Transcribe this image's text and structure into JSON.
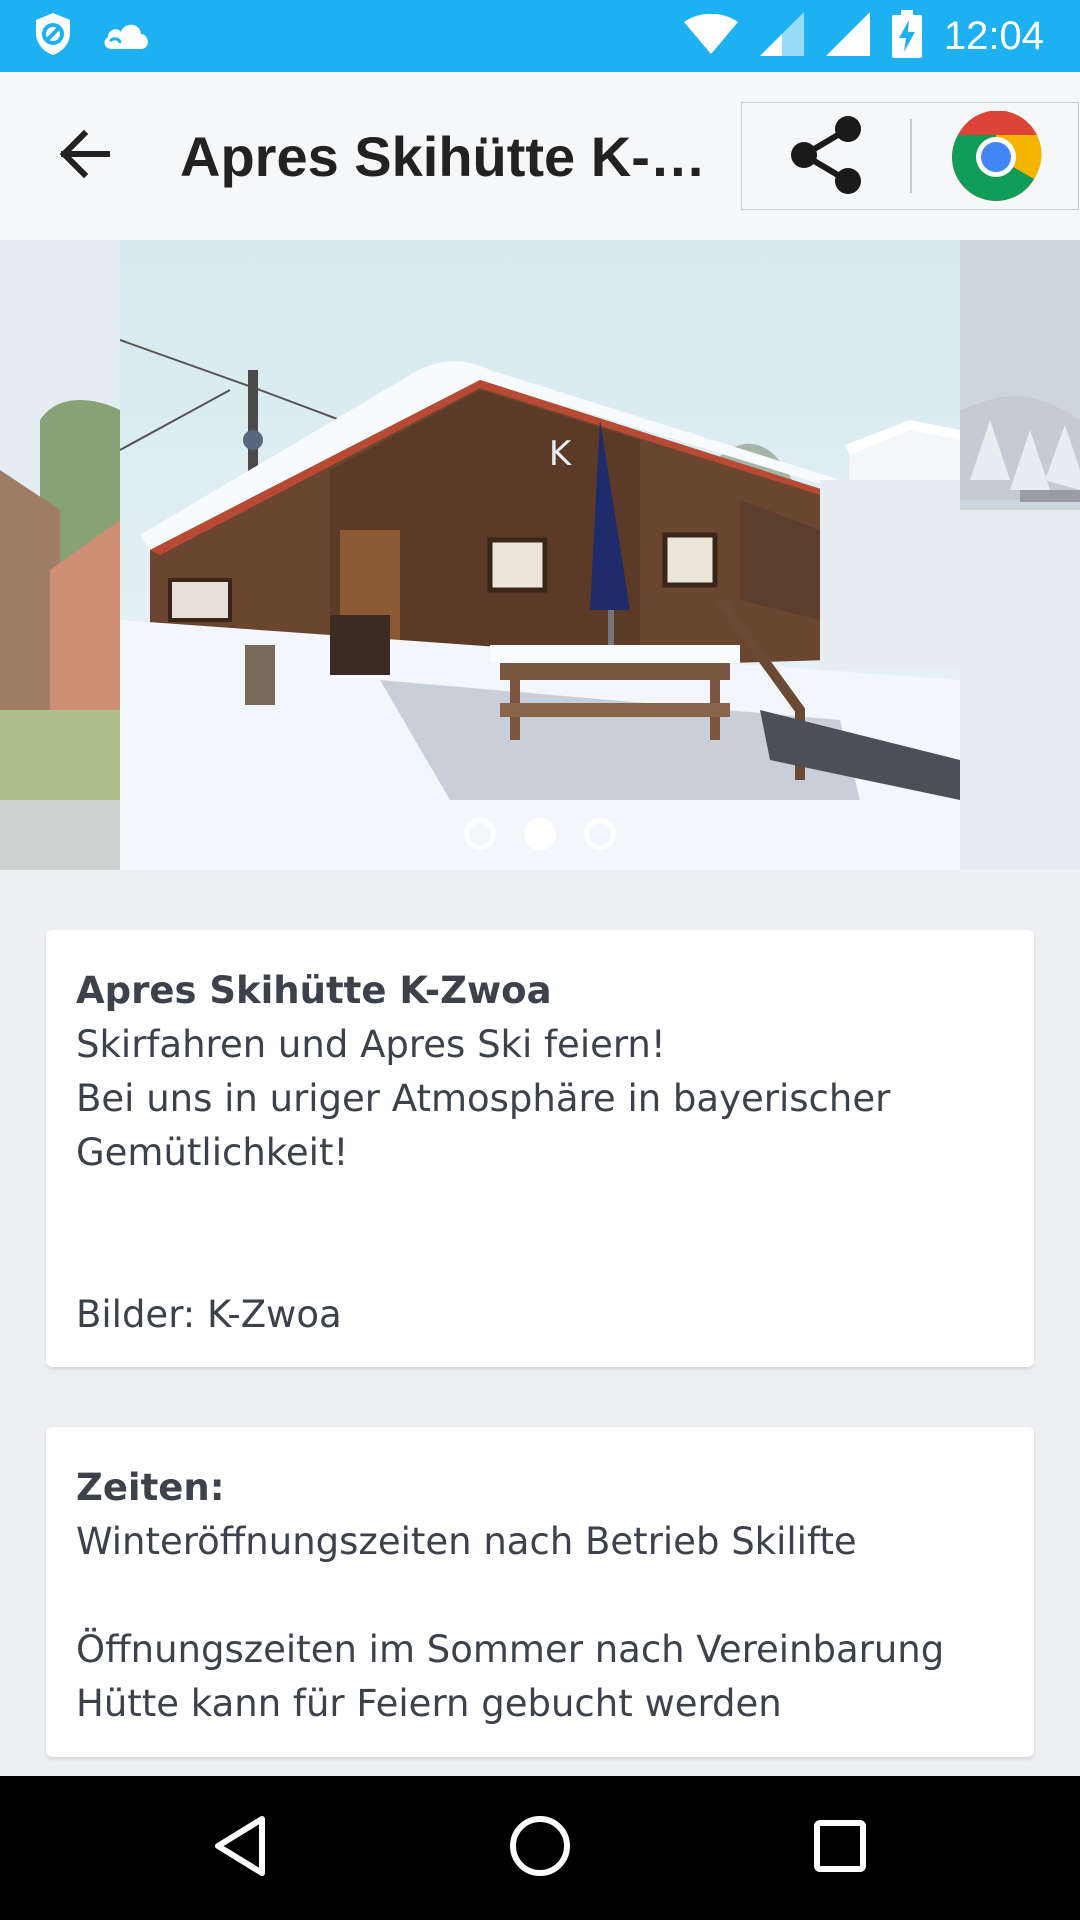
{
  "status_bar": {
    "time": "12:04",
    "icons": [
      "shield-icon",
      "cloud-icon",
      "wifi-icon",
      "signal-icon",
      "signal-icon",
      "battery-charging-icon"
    ]
  },
  "toolbar": {
    "title": "Apres Skihütte K-Zwoa",
    "back_icon": "arrow-left-icon",
    "share_icon": "share-icon",
    "browser_icon": "chrome-icon"
  },
  "carousel": {
    "slide_count": 3,
    "active_index": 1
  },
  "info_card": {
    "title": "Apres Skihütte K-Zwoa",
    "line1": "Skirfahren und Apres Ski feiern!",
    "line2": "Bei uns in uriger Atmosphäre in bayerischer Gemütlichkeit!",
    "credits": "Bilder: K-Zwoa"
  },
  "hours_card": {
    "title": "Zeiten:",
    "winter": "Winteröffnungszeiten nach Betrieb Skilifte",
    "summer": "Öffnungszeiten im Sommer nach Vereinbarung",
    "events": "Hütte kann für Feiern gebucht werden"
  },
  "nav_bar": {
    "icons": [
      "back-triangle-icon",
      "home-circle-icon",
      "recents-square-icon"
    ]
  },
  "colors": {
    "status_bar": "#1eb1f2",
    "background": "#eeeff2",
    "card": "#ffffff",
    "text": "#3d424a"
  }
}
